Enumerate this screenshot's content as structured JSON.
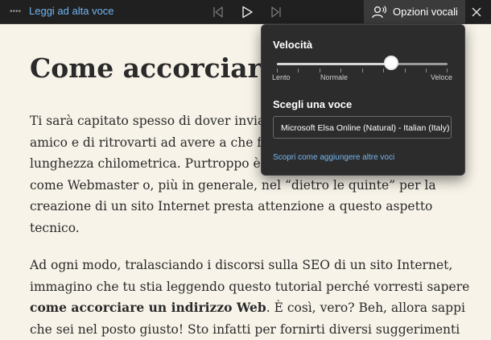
{
  "toolbar": {
    "read_aloud_label": "Leggi ad alta voce",
    "voice_options_label": "Opzioni vocali",
    "icons": [
      "grip-icon",
      "skip-previous-icon",
      "play-icon",
      "skip-next-icon",
      "voice-icon",
      "close-icon"
    ]
  },
  "article": {
    "title": "Come accorciare",
    "p1_lines": [
      "Ti sarà capitato spesso di dover invia",
      "amico e di ritrovarti ad avere a che fa",
      "lunghezza chilometrica. Purtroppo è c",
      "come Webmaster o, più in generale, nel “dietro le quinte” per la",
      "creazione di un sito Internet presta attenzione a questo aspetto",
      "tecnico."
    ],
    "p2_line1": "Ad ogni modo, tralasciando i discorsi sulla SEO di un sito Internet,",
    "p2_line2": "immagino che tu stia leggendo questo tutorial perché vorresti sapere",
    "p2_bold": "come accorciare un indirizzo Web",
    "p2_line3_rest": ". È così, vero? Beh, allora sappi",
    "p2_line4": "che sei nel posto giusto! Sto infatti per fornirti diversi suggerimenti"
  },
  "voice_panel": {
    "speed_label": "Velocità",
    "speed_level": 0.67,
    "tick_labels": {
      "slow": "Lento",
      "normal": "Normale",
      "fast": "Veloce"
    },
    "choose_voice_label": "Scegli una voce",
    "selected_voice": "Microsoft Elsa Online (Natural) - Italian (Italy)",
    "discover_link": "Scopri come aggiungere altre voci"
  },
  "colors": {
    "toolbar_bg": "#202020",
    "page_bg": "#f7f3e8",
    "link": "#6fb4f2",
    "panel_bg": "#2c2c2c"
  }
}
